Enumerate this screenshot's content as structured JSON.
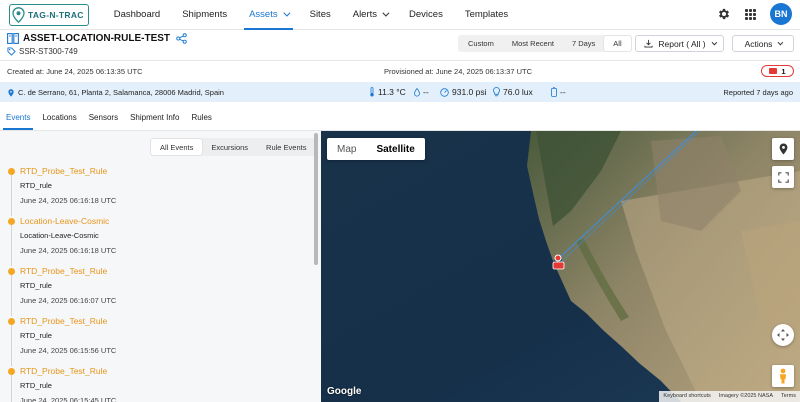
{
  "nav": {
    "brand": "TAG-N-TRAC",
    "links": [
      {
        "label": "Dashboard",
        "dropdown": false,
        "active": false
      },
      {
        "label": "Shipments",
        "dropdown": false,
        "active": false
      },
      {
        "label": "Assets",
        "dropdown": true,
        "active": true
      },
      {
        "label": "Sites",
        "dropdown": false,
        "active": false
      },
      {
        "label": "Alerts",
        "dropdown": true,
        "active": false
      },
      {
        "label": "Devices",
        "dropdown": false,
        "active": false
      },
      {
        "label": "Templates",
        "dropdown": false,
        "active": false
      }
    ],
    "user_initials": "BN"
  },
  "asset": {
    "title": "ASSET-LOCATION-RULE-TEST",
    "device_id": "SSR-ST300-749",
    "created": "Created at: June 24, 2025 06:13:35 UTC",
    "provisioned": "Provisioned at: June 24, 2025 06:13:37 UTC",
    "alert_count": "1"
  },
  "time_range": {
    "options": [
      "Custom",
      "Most Recent",
      "7 Days",
      "All"
    ],
    "selected": "All"
  },
  "buttons": {
    "report": "Report ( All )",
    "actions": "Actions"
  },
  "location_bar": {
    "address": "C. de Serrano, 61, Planta 2, Salamanca, 28006 Madrid, Spain",
    "temperature": "11.3 °C",
    "humidity": "--",
    "pressure": "931.0 psi",
    "light": "76.0 lux",
    "battery": "--",
    "reported": "Reported 7 days ago"
  },
  "tabs": [
    "Events",
    "Locations",
    "Sensors",
    "Shipment Info",
    "Rules"
  ],
  "active_tab": "Events",
  "event_filters": {
    "options": [
      "All Events",
      "Excursions",
      "Rule Events"
    ],
    "selected": "All Events"
  },
  "events": [
    {
      "title": "RTD_Probe_Test_Rule",
      "rule": "RTD_rule",
      "time": "June 24, 2025 06:16:18 UTC"
    },
    {
      "title": "Location-Leave-Cosmic",
      "rule": "Location-Leave-Cosmic",
      "time": "June 24, 2025 06:16:18 UTC"
    },
    {
      "title": "RTD_Probe_Test_Rule",
      "rule": "RTD_rule",
      "time": "June 24, 2025 06:16:07 UTC"
    },
    {
      "title": "RTD_Probe_Test_Rule",
      "rule": "RTD_rule",
      "time": "June 24, 2025 06:15:56 UTC"
    },
    {
      "title": "RTD_Probe_Test_Rule",
      "rule": "RTD_rule",
      "time": "June 24, 2025 06:15:45 UTC"
    }
  ],
  "map": {
    "types": [
      "Map",
      "Satellite"
    ],
    "selected_type": "Satellite",
    "logo": "Google",
    "attribution": [
      "Keyboard shortcuts",
      "Imagery ©2025 NASA",
      "Terms"
    ]
  },
  "colors": {
    "accent": "#1976d2",
    "event_dot": "#f5a623",
    "event_title": "#e8951a",
    "alert": "#e53935",
    "location_bar_bg": "#e3f0fc"
  }
}
